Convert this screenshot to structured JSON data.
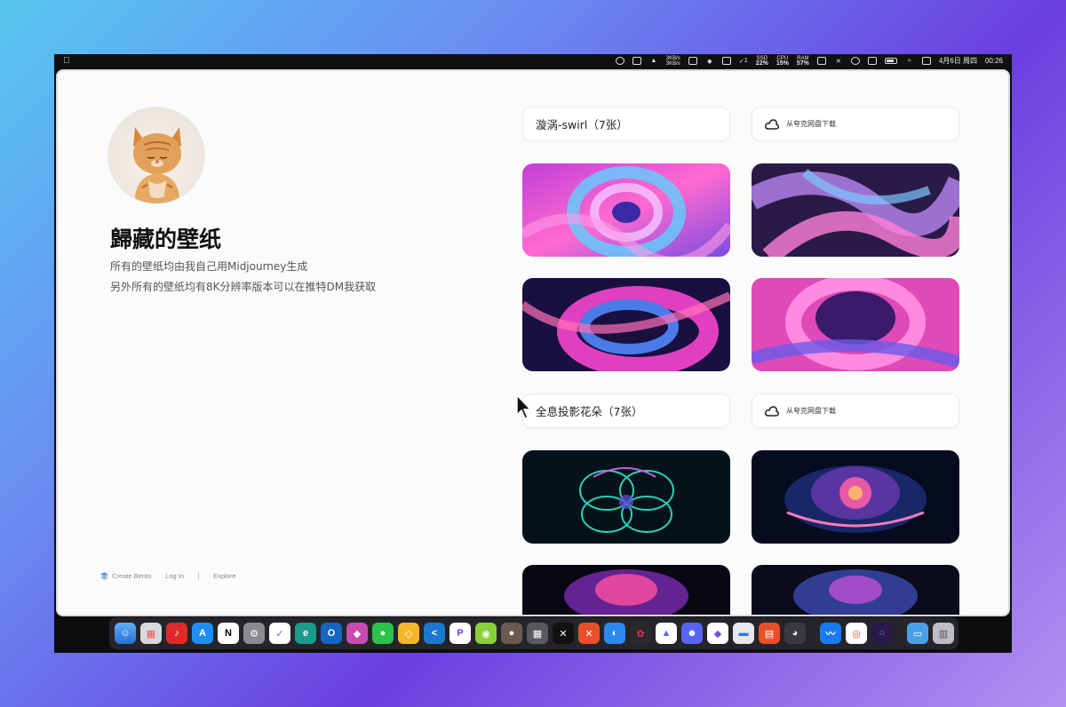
{
  "menubar": {
    "net_up": "3KB/s",
    "net_down": "3KB/s",
    "badge_count": "1",
    "ssd_label": "SSD",
    "ssd_value": "22%",
    "cpu_label": "CPU",
    "cpu_value": "15%",
    "ram_label": "RAM",
    "ram_value": "57%",
    "date": "4月6日 周四",
    "time": "00:26"
  },
  "profile": {
    "name": "歸藏的壁纸",
    "line1": "所有的壁纸均由我自己用Midjourney生成",
    "line2": "另外所有的壁纸均有8K分辨率版本可以在推特DM我获取"
  },
  "sections": [
    {
      "title": "漩涡-swirl（7张）",
      "download_label": "从夸克网盘下载"
    },
    {
      "title": "全息投影花朵（7张）",
      "download_label": "从夸克网盘下载"
    }
  ],
  "footer": {
    "create": "Create Bento",
    "login": "Log In",
    "explore": "Explore"
  },
  "colors": {
    "swirl_magenta": "#e040c0",
    "swirl_blue": "#4a7be8",
    "flower_teal": "#2ee6c8",
    "flower_pink": "#ff5fa8",
    "page_bg": "#fbfbfc"
  },
  "dock_icons": [
    "finder-icon",
    "launchpad-icon",
    "netease-music-icon",
    "app-store-icon",
    "notion-icon",
    "system-settings-icon",
    "ticktick-icon",
    "edge-icon",
    "outlook-icon",
    "setapp-icon",
    "wechat-icon",
    "sketch-icon",
    "vscode-icon",
    "pockity-icon",
    "app-green-icon",
    "app-orb-icon",
    "calculator-icon",
    "capcut-icon",
    "app-x-icon",
    "browser-blue-icon",
    "figma-icon",
    "craft-icon",
    "discord-icon",
    "obsidian-icon",
    "keynote-icon",
    "fantastical-icon",
    "cat-app-icon",
    "app-blue-icon",
    "chrome-icon",
    "arc-icon",
    "downloads-folder-icon",
    "trash-icon"
  ]
}
